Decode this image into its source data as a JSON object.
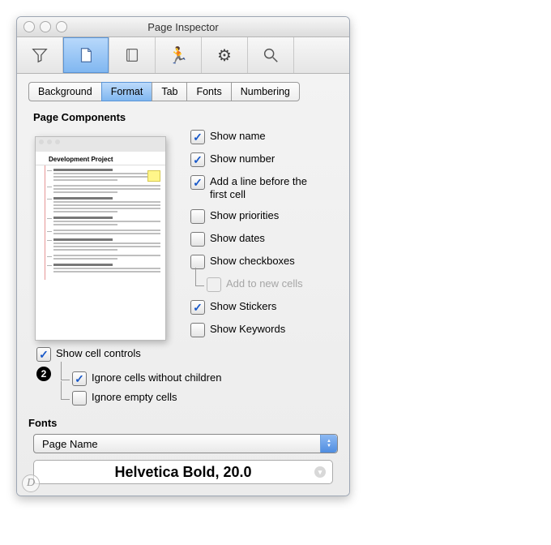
{
  "window": {
    "title": "Page Inspector"
  },
  "tabs": [
    {
      "label": "Background",
      "selected": false
    },
    {
      "label": "Format",
      "selected": true
    },
    {
      "label": "Tab",
      "selected": false
    },
    {
      "label": "Fonts",
      "selected": false
    },
    {
      "label": "Numbering",
      "selected": false
    }
  ],
  "section": {
    "page_components": "Page Components",
    "fonts": "Fonts"
  },
  "preview": {
    "title": "Development Project"
  },
  "checks": {
    "show_name": {
      "label": "Show name",
      "checked": true
    },
    "show_number": {
      "label": "Show number",
      "checked": true
    },
    "add_line": {
      "label": "Add a line before the first cell",
      "checked": true
    },
    "show_priorities": {
      "label": "Show priorities",
      "checked": false
    },
    "show_dates": {
      "label": "Show dates",
      "checked": false
    },
    "show_checkboxes": {
      "label": "Show checkboxes",
      "checked": false
    },
    "add_to_new": {
      "label": "Add to new cells",
      "checked": false,
      "disabled": true
    },
    "show_stickers": {
      "label": "Show Stickers",
      "checked": true
    },
    "show_keywords": {
      "label": "Show Keywords",
      "checked": false
    },
    "show_cell_ctrl": {
      "label": "Show cell controls",
      "checked": true
    },
    "ignore_nochild": {
      "label": "Ignore cells without children",
      "checked": true
    },
    "ignore_empty": {
      "label": "Ignore empty cells",
      "checked": false
    }
  },
  "badge": "2",
  "fonts": {
    "popup": "Page Name",
    "sample": "Helvetica Bold, 20.0"
  }
}
